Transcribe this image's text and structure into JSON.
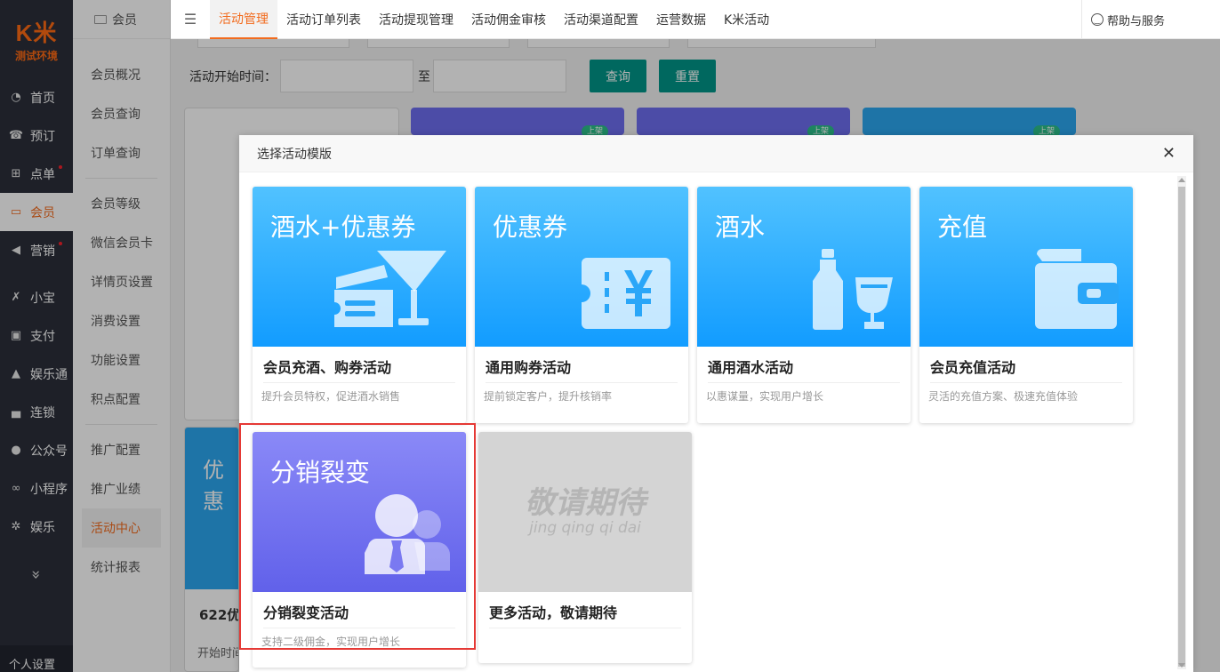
{
  "logo": {
    "mark": "K米",
    "env": "测试环境"
  },
  "left_nav": [
    {
      "label": "首页",
      "icon": "dashboard-icon"
    },
    {
      "label": "预订",
      "icon": "phone-icon"
    },
    {
      "label": "点单",
      "icon": "basket-icon",
      "dot": true
    },
    {
      "label": "会员",
      "icon": "card-icon",
      "active": true
    },
    {
      "label": "营销",
      "icon": "megaphone-icon",
      "dot": true
    },
    {
      "label": "小宝",
      "icon": "x-icon"
    },
    {
      "label": "支付",
      "icon": "payment-icon"
    },
    {
      "label": "娱乐通",
      "icon": "lock-icon"
    },
    {
      "label": "连锁",
      "icon": "bag-icon"
    },
    {
      "label": "公众号",
      "icon": "wechat-icon"
    },
    {
      "label": "小程序",
      "icon": "miniprogram-icon"
    },
    {
      "label": "娱乐",
      "icon": "settings-icon"
    }
  ],
  "left_nav_more": "»",
  "left_nav_bottom": "个人设置",
  "sub_nav": {
    "title": "会员",
    "items": [
      "会员概况",
      "会员查询",
      "订单查询",
      "会员等级",
      "微信会员卡",
      "详情页设置",
      "消费设置",
      "功能设置",
      "积点配置",
      "推广配置",
      "推广业绩",
      "活动中心",
      "统计报表"
    ],
    "active": "活动中心"
  },
  "top_tabs": [
    "活动管理",
    "活动订单列表",
    "活动提现管理",
    "活动佣金审核",
    "活动渠道配置",
    "运营数据",
    "K米活动"
  ],
  "active_tab": "活动管理",
  "help": "帮助与服务",
  "filter": {
    "start_label": "活动开始时间：",
    "to": "至",
    "query": "查询",
    "reset": "重置"
  },
  "bg_cards": {
    "card_text": "优惠",
    "card_title": "622优",
    "card_sub": "开始时间",
    "status": "上架"
  },
  "modal": {
    "title": "选择活动模版",
    "templates": [
      {
        "banner": "酒水+优惠券",
        "name": "会员充酒、购券活动",
        "desc": "提升会员特权，促进酒水销售",
        "style": "blue",
        "icon": "cocktail-coupon-icon"
      },
      {
        "banner": "优惠券",
        "name": "通用购券活动",
        "desc": "提前锁定客户，提升核销率",
        "style": "blue",
        "icon": "coupon-icon"
      },
      {
        "banner": "酒水",
        "name": "通用酒水活动",
        "desc": "以惠谋量，实现用户增长",
        "style": "blue",
        "icon": "bottle-glass-icon"
      },
      {
        "banner": "充值",
        "name": "会员充值活动",
        "desc": "灵活的充值方案、极速充值体验",
        "style": "blue",
        "icon": "wallet-icon"
      },
      {
        "banner": "分销裂变",
        "name": "分销裂变活动",
        "desc": "支持二级佣金，实现用户增长",
        "style": "purple",
        "icon": "users-icon"
      },
      {
        "banner": "敬请期待",
        "banner_sub": "jing qing qi dai",
        "name": "更多活动，敬请期待",
        "desc": "",
        "style": "grey",
        "icon": ""
      }
    ]
  },
  "colors": {
    "accent": "#f26b1d",
    "primary_button": "#009688",
    "sidebar": "#2b2f3a",
    "highlight": "#e53935"
  }
}
